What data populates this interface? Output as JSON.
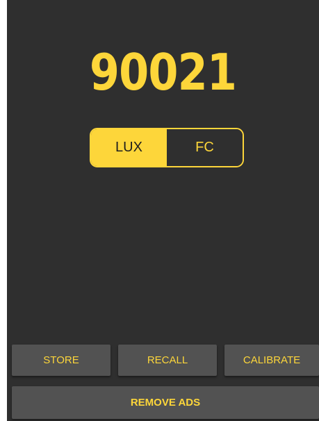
{
  "meter": {
    "reading": "90021"
  },
  "unit_toggle": {
    "options": [
      "LUX",
      "FC"
    ],
    "selected": "LUX"
  },
  "actions": {
    "store": "STORE",
    "recall": "RECALL",
    "calibrate": "CALIBRATE",
    "remove_ads": "REMOVE ADS"
  },
  "colors": {
    "accent": "#fdd63a",
    "background": "#2f2f2f",
    "button": "#525252"
  }
}
